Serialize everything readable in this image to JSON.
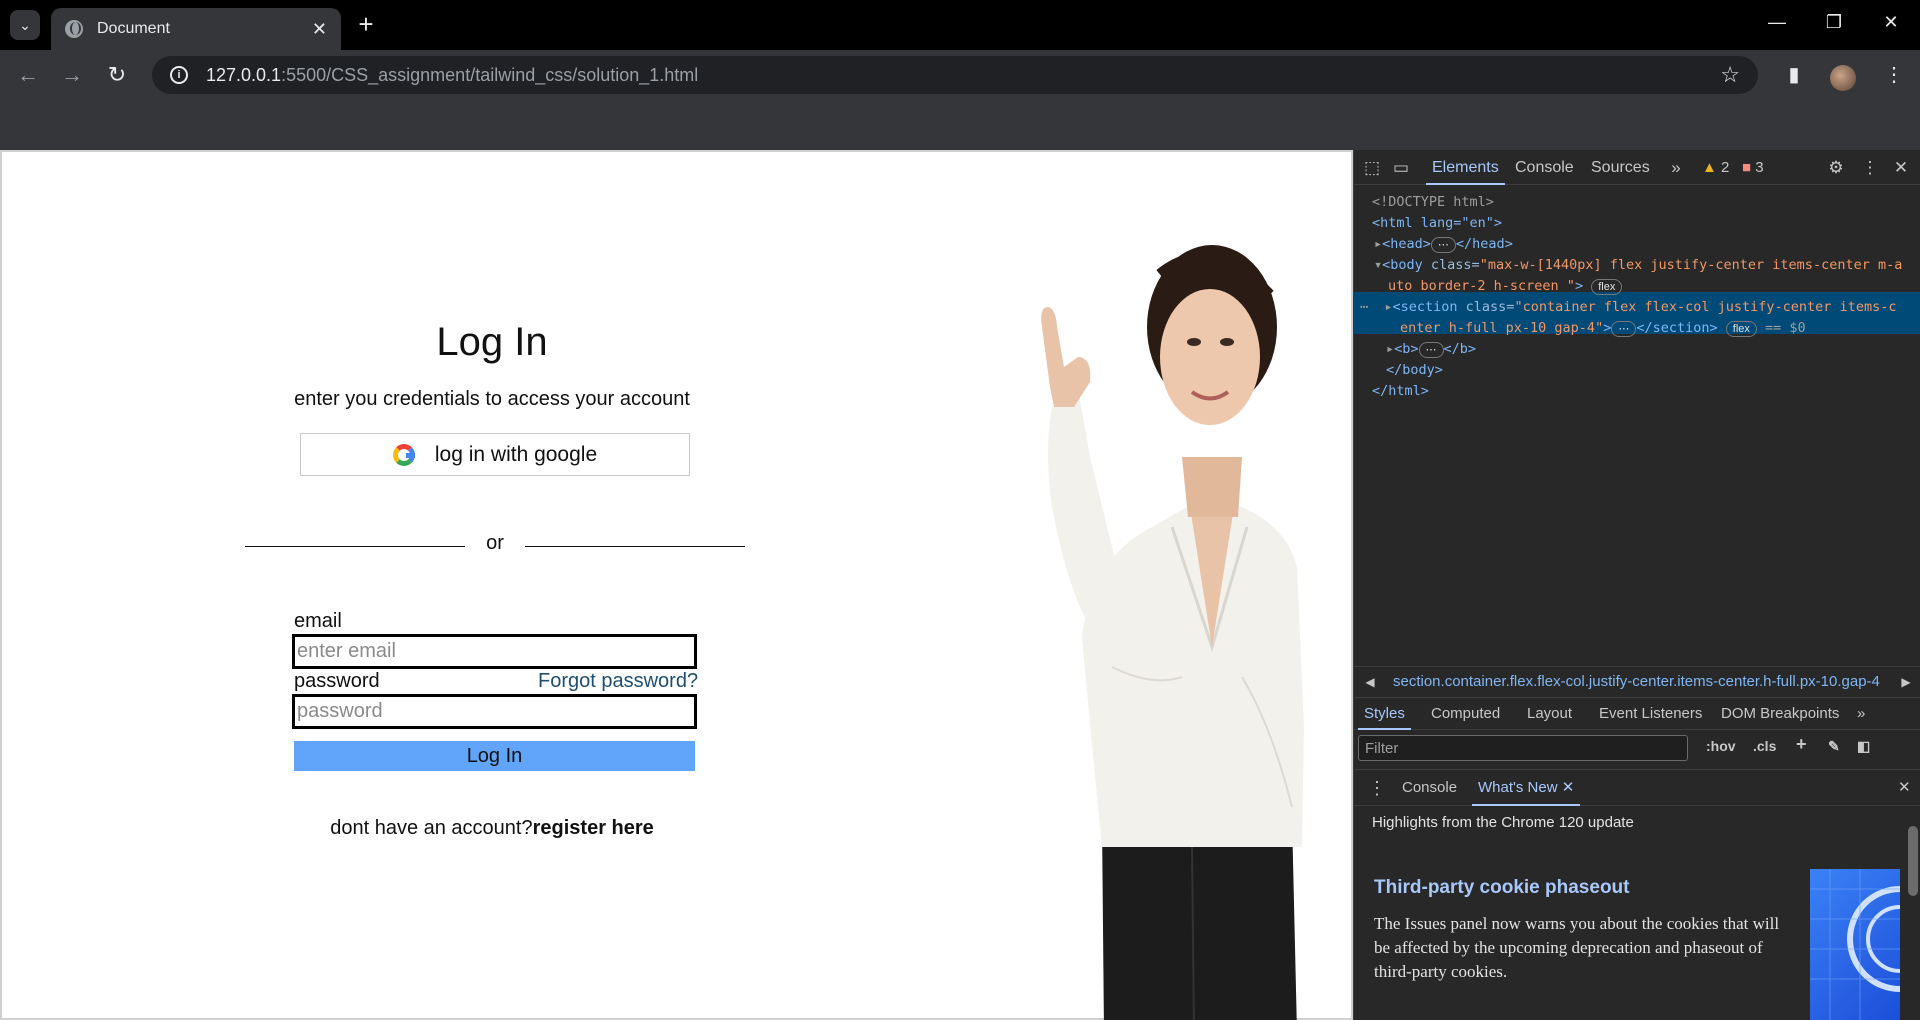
{
  "browser": {
    "tab_title": "Document",
    "url_host": "127.0.0.1",
    "url_path": ":5500/CSS_assignment/tailwind_css/solution_1.html"
  },
  "page": {
    "heading": "Log In",
    "subtitle": "enter you credentials to access your account",
    "google_button": "log in with google",
    "divider_text": "or",
    "email_label": "email",
    "email_placeholder": "enter email",
    "password_label": "password",
    "password_placeholder": "password",
    "forgot_link": "Forgot password?",
    "submit_button": "Log In",
    "register_prompt": "dont have an account?",
    "register_link": "register here"
  },
  "devtools": {
    "tabs": [
      "Elements",
      "Console",
      "Sources"
    ],
    "warnings_count": "2",
    "errors_count": "3",
    "breadcrumb": "section.container.flex.flex-col.justify-center.items-center.h-full.px-10.gap-4",
    "style_tabs": [
      "Styles",
      "Computed",
      "Layout",
      "Event Listeners",
      "DOM Breakpoints"
    ],
    "filter_placeholder": "Filter",
    "hov": ":hov",
    "cls": ".cls",
    "drawer_tabs": [
      "Console",
      "What's New"
    ],
    "highlights": "Highlights from the Chrome 120 update",
    "whatsnew_title": "Third-party cookie phaseout",
    "whatsnew_body": "The Issues panel now warns you about the cookies that will be affected by the upcoming deprecation and phaseout of third-party cookies.",
    "dom": {
      "doctype": "<!DOCTYPE html>",
      "html_open": "<html lang=\"en\">",
      "head": "<head>",
      "head_close": "</head>",
      "body_class_1": "\"max-w-[1440px] flex justify-center items-center m-a",
      "body_class_2": "uto border-2 h-screen \"",
      "section_class_1": "\"container flex flex-col justify-center items-c",
      "section_class_2": "enter h-full px-10 gap-4\"",
      "section_close": "</section>",
      "eq": "== $0",
      "b_open": "<b>",
      "b_close": "</b>",
      "body_close": "</body>",
      "html_close": "</html>",
      "flex_badge": "flex"
    }
  }
}
